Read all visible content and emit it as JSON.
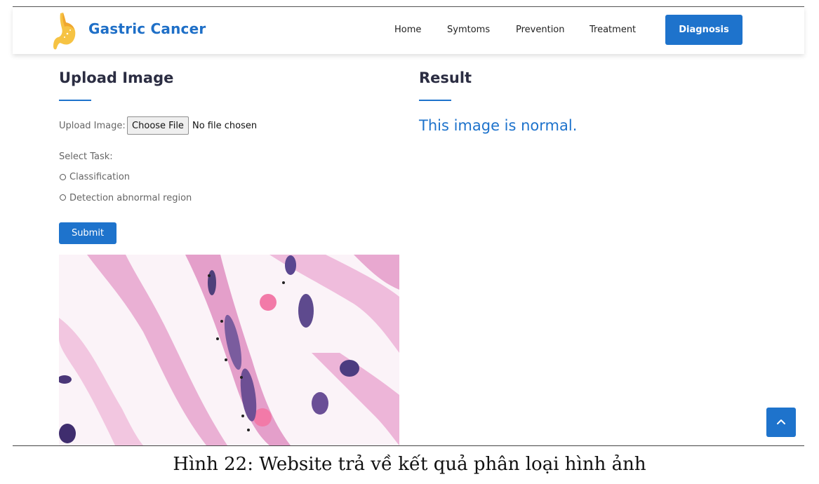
{
  "header": {
    "brand": "Gastric Cancer",
    "nav": [
      "Home",
      "Symtoms",
      "Prevention",
      "Treatment"
    ],
    "cta": "Diagnosis"
  },
  "upload": {
    "title": "Upload Image",
    "field_label": "Upload Image:",
    "file_button": "Choose File",
    "file_status": "No file chosen",
    "task_label": "Select Task:",
    "options": [
      "Classification",
      "Detection abnormal region"
    ],
    "submit": "Submit"
  },
  "result": {
    "title": "Result",
    "text": "This image is normal."
  },
  "caption": "Hình 22: Website trả về kết quả phân loại hình ảnh",
  "colors": {
    "accent": "#1e73cc",
    "heading": "#2b2d42"
  }
}
